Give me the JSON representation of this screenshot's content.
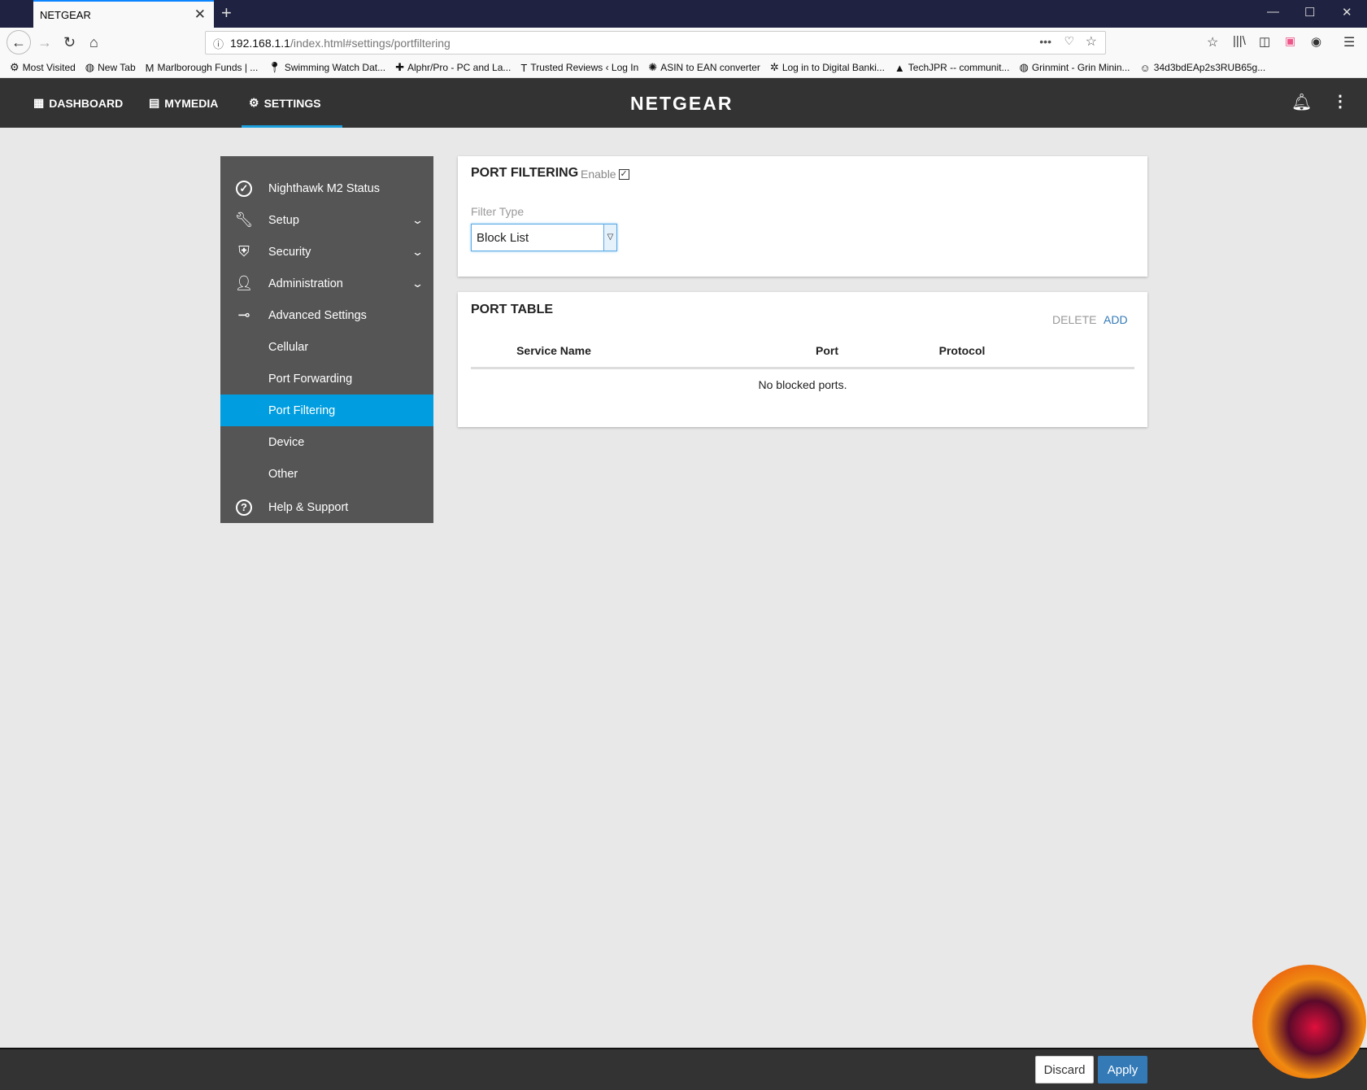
{
  "browser": {
    "tab_title": "NETGEAR",
    "url_host": "192.168.1.1",
    "url_path": "/index.html#settings/portfiltering",
    "bookmarks": [
      {
        "icon": "gear-icon",
        "label": "Most Visited"
      },
      {
        "icon": "globe-icon",
        "label": "New Tab"
      },
      {
        "icon": "m-logo-icon",
        "label": "Marlborough Funds | ..."
      },
      {
        "icon": "pin-icon",
        "label": "Swimming Watch Dat..."
      },
      {
        "icon": "plus-logo-icon",
        "label": "Alphr/Pro - PC and La..."
      },
      {
        "icon": "t-logo-icon",
        "label": "Trusted Reviews ‹ Log In"
      },
      {
        "icon": "gear-blue-icon",
        "label": "ASIN to EAN converter"
      },
      {
        "icon": "bank-logo-icon",
        "label": "Log in to Digital Banki..."
      },
      {
        "icon": "drive-icon",
        "label": "TechJPR -- communit..."
      },
      {
        "icon": "globe-icon",
        "label": "Grinmint - Grin Minin..."
      },
      {
        "icon": "smiley-icon",
        "label": "34d3bdEAp2s3RUB65g..."
      }
    ]
  },
  "header": {
    "nav": [
      {
        "icon": "dashboard-icon",
        "label": "DASHBOARD"
      },
      {
        "icon": "media-icon",
        "label": "MYMEDIA"
      },
      {
        "icon": "gear-icon",
        "label": "SETTINGS"
      }
    ],
    "logo": "NETGEAR",
    "accent": "#1aa0dc"
  },
  "sidebar": {
    "items": [
      {
        "icon": "check-circle-icon",
        "label": "Nighthawk M2 Status"
      },
      {
        "icon": "wrench-icon",
        "label": "Setup",
        "chevron": true
      },
      {
        "icon": "shield-icon",
        "label": "Security",
        "chevron": true
      },
      {
        "icon": "user-icon",
        "label": "Administration",
        "chevron": true
      },
      {
        "icon": "toggle-icon",
        "label": "Advanced Settings"
      },
      {
        "label": "Cellular"
      },
      {
        "label": "Port Forwarding"
      },
      {
        "label": "Port Filtering",
        "active": true
      },
      {
        "label": "Device"
      },
      {
        "label": "Other"
      },
      {
        "icon": "help-icon",
        "label": "Help & Support"
      }
    ],
    "active_color": "#009ee0"
  },
  "port_filtering": {
    "title": "PORT FILTERING",
    "enable_label": "Enable",
    "enabled": true,
    "filter_type_label": "Filter Type",
    "filter_type_value": "Block List"
  },
  "port_table": {
    "title": "PORT TABLE",
    "delete_label": "DELETE",
    "add_label": "ADD",
    "columns": [
      "Service Name",
      "Port",
      "Protocol"
    ],
    "empty_text": "No blocked ports."
  },
  "footer": {
    "discard_label": "Discard",
    "apply_label": "Apply",
    "apply_color": "#337ab7"
  }
}
